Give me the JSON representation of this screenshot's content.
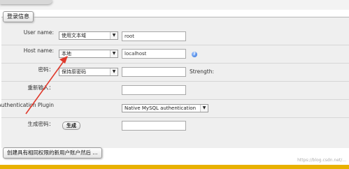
{
  "section": {
    "legend": "登录信息",
    "footer_legend": "创建具有相同权限的新用户账户然后 ..."
  },
  "user_name": {
    "label": "User name:",
    "select_value": "使用文本域",
    "input_value": "root"
  },
  "host_name": {
    "label": "Host name:",
    "select_value": "本地",
    "input_value": "localhost"
  },
  "password": {
    "label": "密码：",
    "select_value": "保持原密码",
    "input_value": "",
    "strength_label": "Strength:"
  },
  "retype": {
    "label": "重新输入：",
    "input_value": ""
  },
  "auth_plugin": {
    "label": "Authentication Plugin",
    "select_value": "Native MySQL authentication"
  },
  "generate_password": {
    "label": "生成密码：",
    "button_label": "生成",
    "input_value": ""
  },
  "watermark": "https://blog.csdn.net/...",
  "colors": {
    "annotation_arrow": "#e0392b",
    "bottom_bar": "#e8b100",
    "panel_bg": "#efefef"
  }
}
